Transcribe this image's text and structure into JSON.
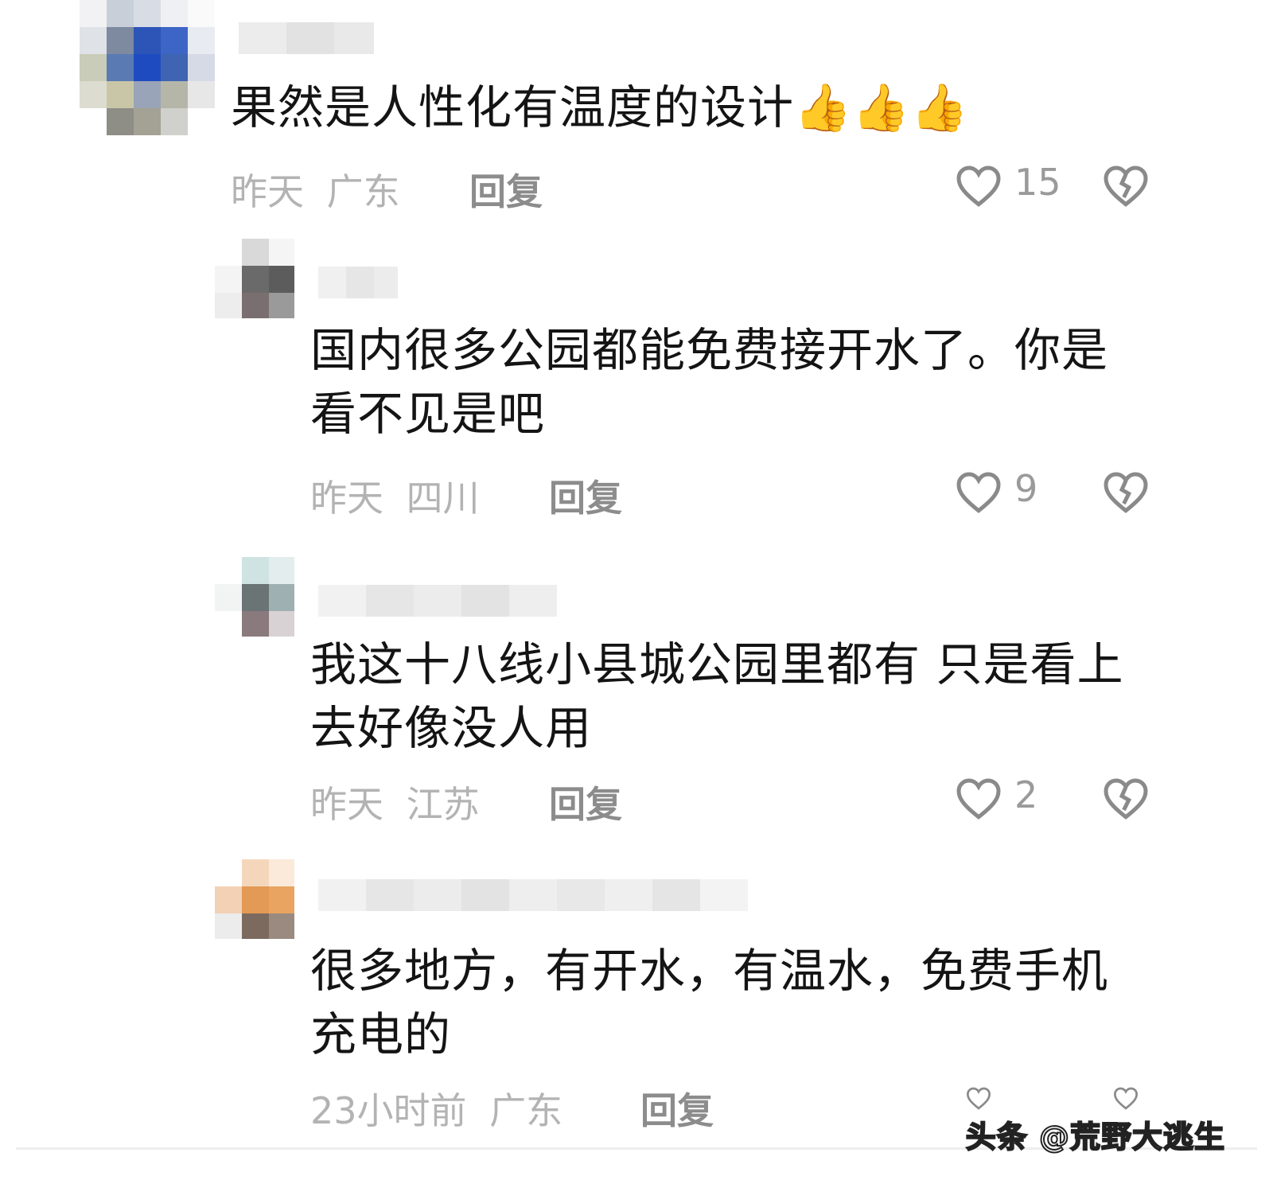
{
  "comments": [
    {
      "text": "果然是人性化有温度的设计",
      "emoji": "👍👍👍",
      "time": "昨天",
      "location": "广东",
      "reply_label": "回复",
      "likes": "15"
    },
    {
      "text": "国内很多公园都能免费接开水了。你是看不见是吧",
      "time": "昨天",
      "location": "四川",
      "reply_label": "回复",
      "likes": "9"
    },
    {
      "text": "我这十八线小县城公园里都有 只是看上去好像没人用",
      "time": "昨天",
      "location": "江苏",
      "reply_label": "回复",
      "likes": "2"
    },
    {
      "text": "很多地方，有开水，有温水，免费手机充电的",
      "time": "23小时前",
      "location": "广东",
      "reply_label": "回复"
    }
  ],
  "watermark": "头条 @荒野大逃生"
}
